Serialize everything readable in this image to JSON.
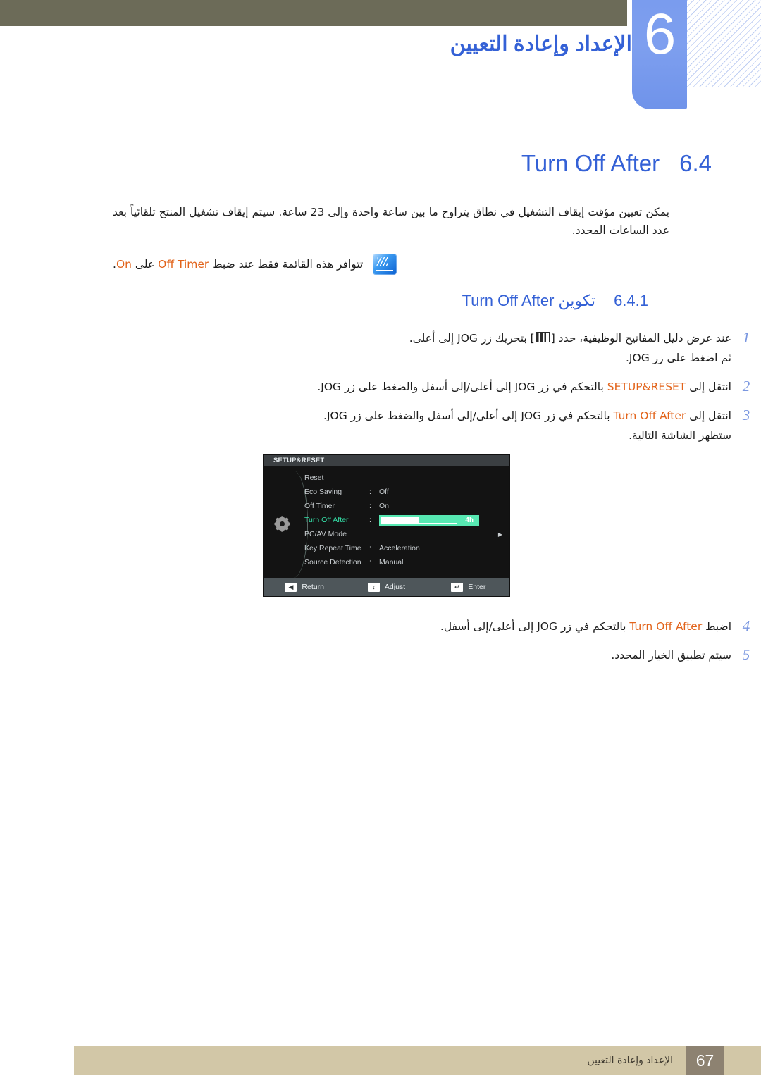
{
  "header": {
    "chapter_number": "6",
    "chapter_title": "الإعداد وإعادة التعيين"
  },
  "section": {
    "number": "6.4",
    "name": "Turn Off After"
  },
  "intro_paragraph": "يمكن تعيين مؤقت إيقاف التشغيل في نطاق يتراوح ما بين ساعة واحدة وإلى 23 ساعة. سيتم إيقاف تشغيل المنتج تلقائياً بعد عدد الساعات المحدد.",
  "note": {
    "icon": "note-icon",
    "text_before": "تتوافر هذه القائمة فقط عند ضبط",
    "keyword": "Off Timer",
    "text_middle": "على",
    "keyword2": "On",
    "text_after": "."
  },
  "subsection": {
    "number": "6.4.1",
    "arabic_label": "تكوين",
    "english_label": "Turn Off After"
  },
  "steps": [
    {
      "number": "1",
      "line1_a": "عند عرض دليل المفاتيح الوظيفية، حدد [",
      "keycap": "menu-keycap",
      "line1_b": "] بتحريك زر",
      "jog1": "JOG",
      "line1_c": "إلى أعلى.",
      "line2_a": "ثم اضغط على زر",
      "jog2": "JOG",
      "line2_b": "."
    },
    {
      "number": "2",
      "line1_a": "انتقل إلى",
      "keyword": "SETUP&RESET",
      "line1_b": "بالتحكم في زر",
      "jog1": "JOG",
      "line1_c": "إلى أعلى/إلى أسفل والضغط على زر",
      "jog2": "JOG",
      "line1_d": "."
    },
    {
      "number": "3",
      "line1_a": "انتقل إلى",
      "keyword": "Turn Off After",
      "line1_b": "بالتحكم في زر",
      "jog1": "JOG",
      "line1_c": "إلى أعلى/إلى أسفل والضغط على زر",
      "jog2": "JOG",
      "line1_d": ".",
      "line2": "ستظهر الشاشة التالية."
    }
  ],
  "steps_after": [
    {
      "number": "4",
      "line1_a": "اضبط",
      "keyword": "Turn Off After",
      "line1_b": "بالتحكم في زر",
      "jog1": "JOG",
      "line1_c": "إلى أعلى/إلى أسفل."
    },
    {
      "number": "5",
      "line1_a": "سيتم تطبيق الخيار المحدد."
    }
  ],
  "osd": {
    "title": "SETUP&RESET",
    "gear_icon": "gear-icon",
    "rows": [
      {
        "label": "Reset",
        "colon": "",
        "value": "",
        "selected": false,
        "arrow": ""
      },
      {
        "label": "Eco Saving",
        "colon": ":",
        "value": "Off",
        "selected": false,
        "arrow": ""
      },
      {
        "label": "Off Timer",
        "colon": ":",
        "value": "On",
        "selected": false,
        "arrow": ""
      },
      {
        "label": "Turn Off After",
        "colon": ":",
        "value": "",
        "selected": true,
        "arrow": "",
        "slider_value": "4h",
        "slider_percent": 30
      },
      {
        "label": "PC/AV Mode",
        "colon": "",
        "value": "",
        "selected": false,
        "arrow": "▶"
      },
      {
        "label": "Key Repeat Time",
        "colon": ":",
        "value": "Acceleration",
        "selected": false,
        "arrow": ""
      },
      {
        "label": "Source Detection",
        "colon": ":",
        "value": "Manual",
        "selected": false,
        "arrow": ""
      }
    ],
    "footer": [
      {
        "key": "◀",
        "label": "Return",
        "icon": "left-arrow-key-icon"
      },
      {
        "key": "↕",
        "label": "Adjust",
        "icon": "up-down-arrow-key-icon"
      },
      {
        "key": "↵",
        "label": "Enter",
        "icon": "enter-key-icon"
      }
    ]
  },
  "page_footer": {
    "number": "67",
    "text": "الإعداد وإعادة التعيين"
  },
  "colors": {
    "header_bar": "#6c6b58",
    "chapter_blue": "#7a9cee",
    "heading_blue": "#3461d6",
    "keyword_orange": "#e2631a",
    "step_number_blue": "#7a97e0",
    "osd_selected_green": "#35e0a8",
    "footer_tan": "#d2c7a7",
    "footer_num_brown": "#8d8271"
  }
}
